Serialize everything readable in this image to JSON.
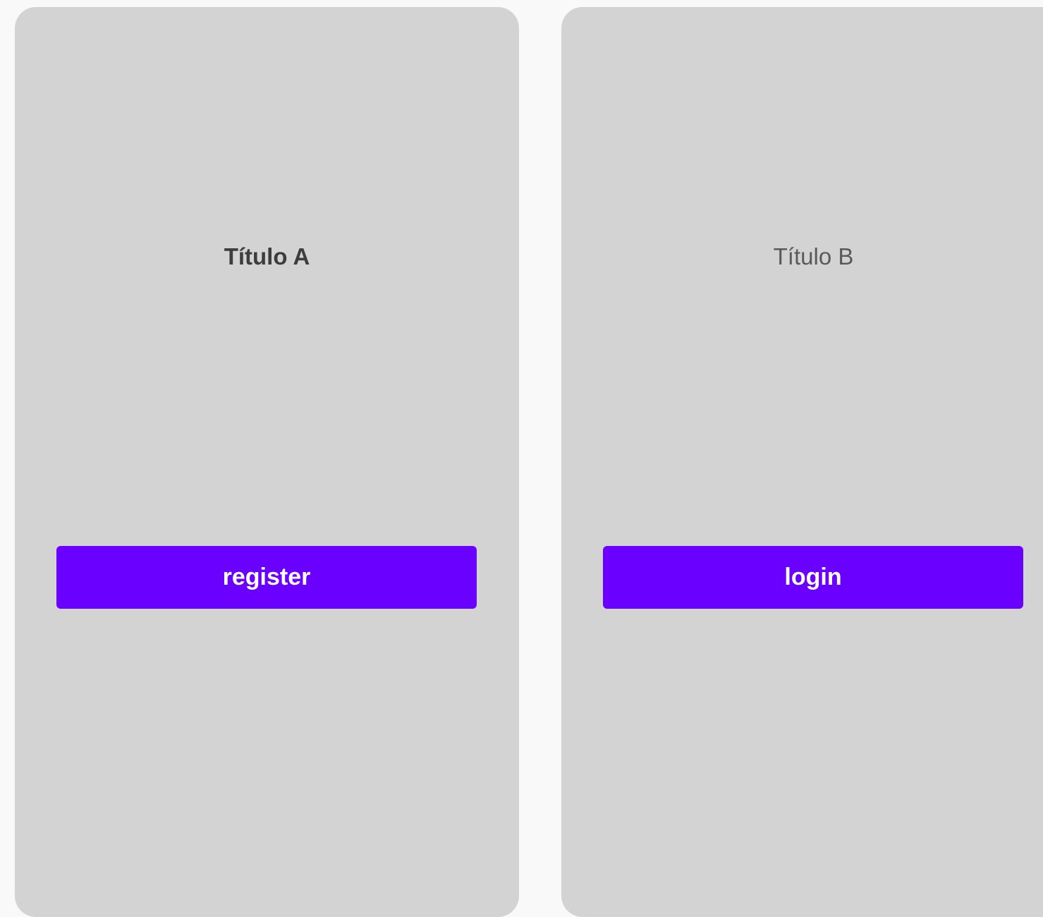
{
  "cards": [
    {
      "title": "Título A",
      "button_label": "register"
    },
    {
      "title": "Título B",
      "button_label": "login"
    }
  ],
  "colors": {
    "page_background": "#f9f9f9",
    "card_background": "#d3d3d3",
    "button_background": "#6a00ff",
    "button_text": "#ffffff",
    "title_text": "#3d3d3d"
  }
}
